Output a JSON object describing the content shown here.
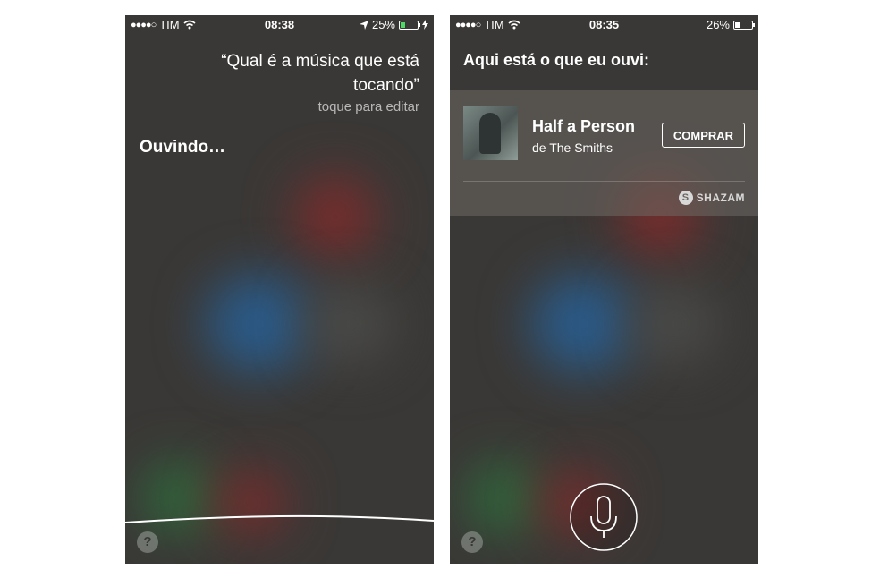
{
  "left_screen": {
    "status": {
      "carrier": "TIM",
      "signal": "●●●●○",
      "time": "08:38",
      "battery": "25%",
      "battery_level": 0.25,
      "battery_color": "#4cd964"
    },
    "query": "“Qual é a música que está tocando”",
    "hint": "toque para editar",
    "listening": "Ouvindo…",
    "help": "?"
  },
  "right_screen": {
    "status": {
      "carrier": "TIM",
      "signal": "●●●●○",
      "time": "08:35",
      "battery": "26%",
      "battery_level": 0.26,
      "battery_color": "#ffffff"
    },
    "heading": "Aqui está o que eu ouvi:",
    "song": {
      "title": "Half a Person",
      "artist": "de The Smiths",
      "buy_label": "COMPRAR"
    },
    "provider": "SHAZAM",
    "help": "?"
  },
  "icons": {
    "wifi": "wifi-icon",
    "location": "location-arrow-icon",
    "charging": "charging-bolt-icon",
    "mic": "microphone-icon",
    "help": "help-icon"
  }
}
